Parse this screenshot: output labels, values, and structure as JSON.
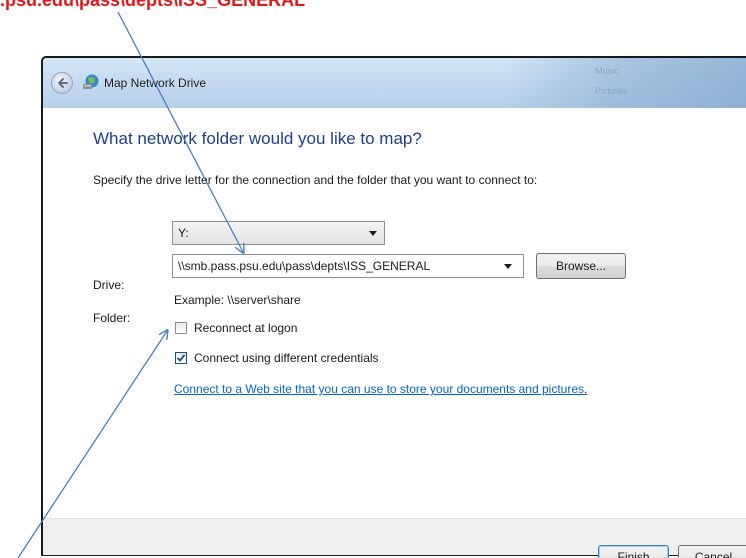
{
  "annotation": {
    "top_text": ".psu.edu\\pass\\depts\\ISS_GENERAL",
    "color": "#e41818"
  },
  "window": {
    "title": "Map Network Drive",
    "ghost_items": [
      "Music",
      "Pictures"
    ],
    "icons": {
      "back": "back-arrow-icon",
      "app": "network-drive-icon"
    }
  },
  "wizard": {
    "heading": "What network folder would you like to map?",
    "instruction": "Specify the drive letter for the connection and the folder that you want to connect to:",
    "drive_label": "Drive:",
    "drive_value": "Y:",
    "folder_label": "Folder:",
    "folder_value": "\\\\smb.pass.psu.edu\\pass\\depts\\ISS_GENERAL",
    "browse_label": "Browse...",
    "example_text": "Example: \\\\server\\share",
    "reconnect_label": "Reconnect at logon",
    "reconnect_checked": false,
    "credentials_label": "Connect using different credentials",
    "credentials_checked": true,
    "link_text": "Connect to a Web site that you can use to store your documents and pictures",
    "link_period": "."
  },
  "footer": {
    "finish_label": "Finish",
    "cancel_label": "Cancel"
  },
  "colors": {
    "heading": "#1e3f8f",
    "link": "#0066cc",
    "arrow": "#4a7ebb"
  }
}
